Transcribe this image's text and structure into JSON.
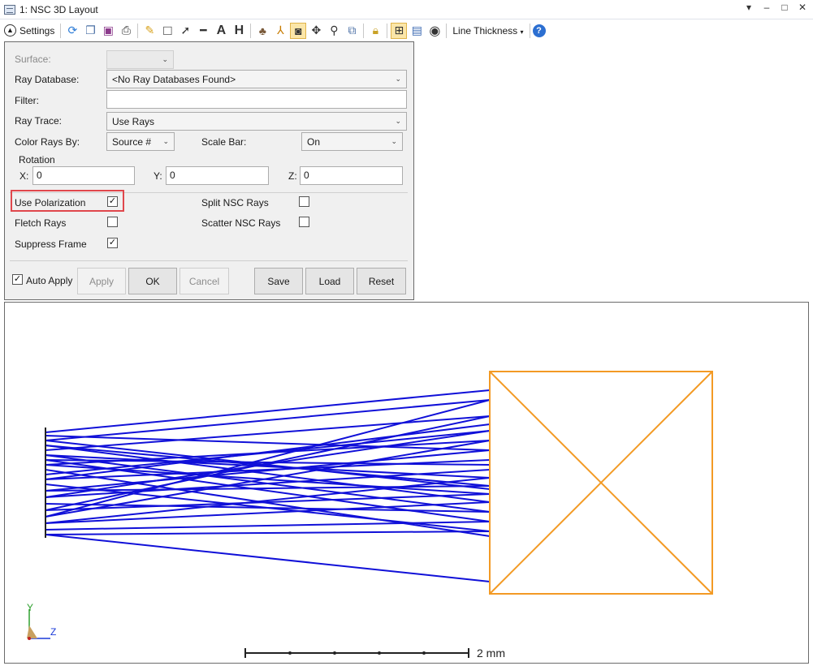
{
  "window": {
    "title": "1: NSC 3D Layout"
  },
  "toolbar": {
    "settings_label": "Settings",
    "line_thickness_label": "Line Thickness",
    "icons": [
      "refresh-icon",
      "copy-icon",
      "save-icon",
      "print-icon",
      "pencil-icon",
      "rectangle-icon",
      "arrow-icon",
      "line-icon",
      "text-icon",
      "dimension-icon",
      "object-visibility-icon",
      "axes-icon",
      "camera-icon",
      "pan-icon",
      "zoom-icon",
      "export-icon",
      "lock-icon",
      "fit-icon",
      "window-icon",
      "rotate-icon",
      "help-icon"
    ]
  },
  "settings": {
    "surface": {
      "label": "Surface:",
      "value": ""
    },
    "ray_database": {
      "label": "Ray Database:",
      "value": "<No Ray Databases Found>"
    },
    "filter": {
      "label": "Filter:",
      "value": ""
    },
    "ray_trace": {
      "label": "Ray Trace:",
      "value": "Use Rays"
    },
    "color_rays_by": {
      "label": "Color Rays By:",
      "value": "Source #"
    },
    "scale_bar": {
      "label": "Scale Bar:",
      "value": "On"
    },
    "rotation": {
      "label": "Rotation",
      "x_label": "X:",
      "x": "0",
      "y_label": "Y:",
      "y": "0",
      "z_label": "Z:",
      "z": "0"
    },
    "use_polarization": {
      "label": "Use Polarization",
      "checked": true
    },
    "split_nsc_rays": {
      "label": "Split NSC Rays",
      "checked": false
    },
    "fletch_rays": {
      "label": "Fletch Rays",
      "checked": false
    },
    "scatter_nsc_rays": {
      "label": "Scatter NSC Rays",
      "checked": false
    },
    "suppress_frame": {
      "label": "Suppress Frame",
      "checked": true
    },
    "auto_apply": {
      "label": "Auto Apply",
      "checked": true
    },
    "buttons": {
      "apply": "Apply",
      "ok": "OK",
      "cancel": "Cancel",
      "save": "Save",
      "load": "Load",
      "reset": "Reset"
    }
  },
  "plot": {
    "ray_color": "#1010d8",
    "object_color": "#f39a24",
    "axis_y_label": "Y",
    "axis_z_label": "Z",
    "scale_bar_label": "2 mm"
  },
  "colors": {
    "highlight": "#e0474c",
    "help": "#2c6fd1"
  }
}
